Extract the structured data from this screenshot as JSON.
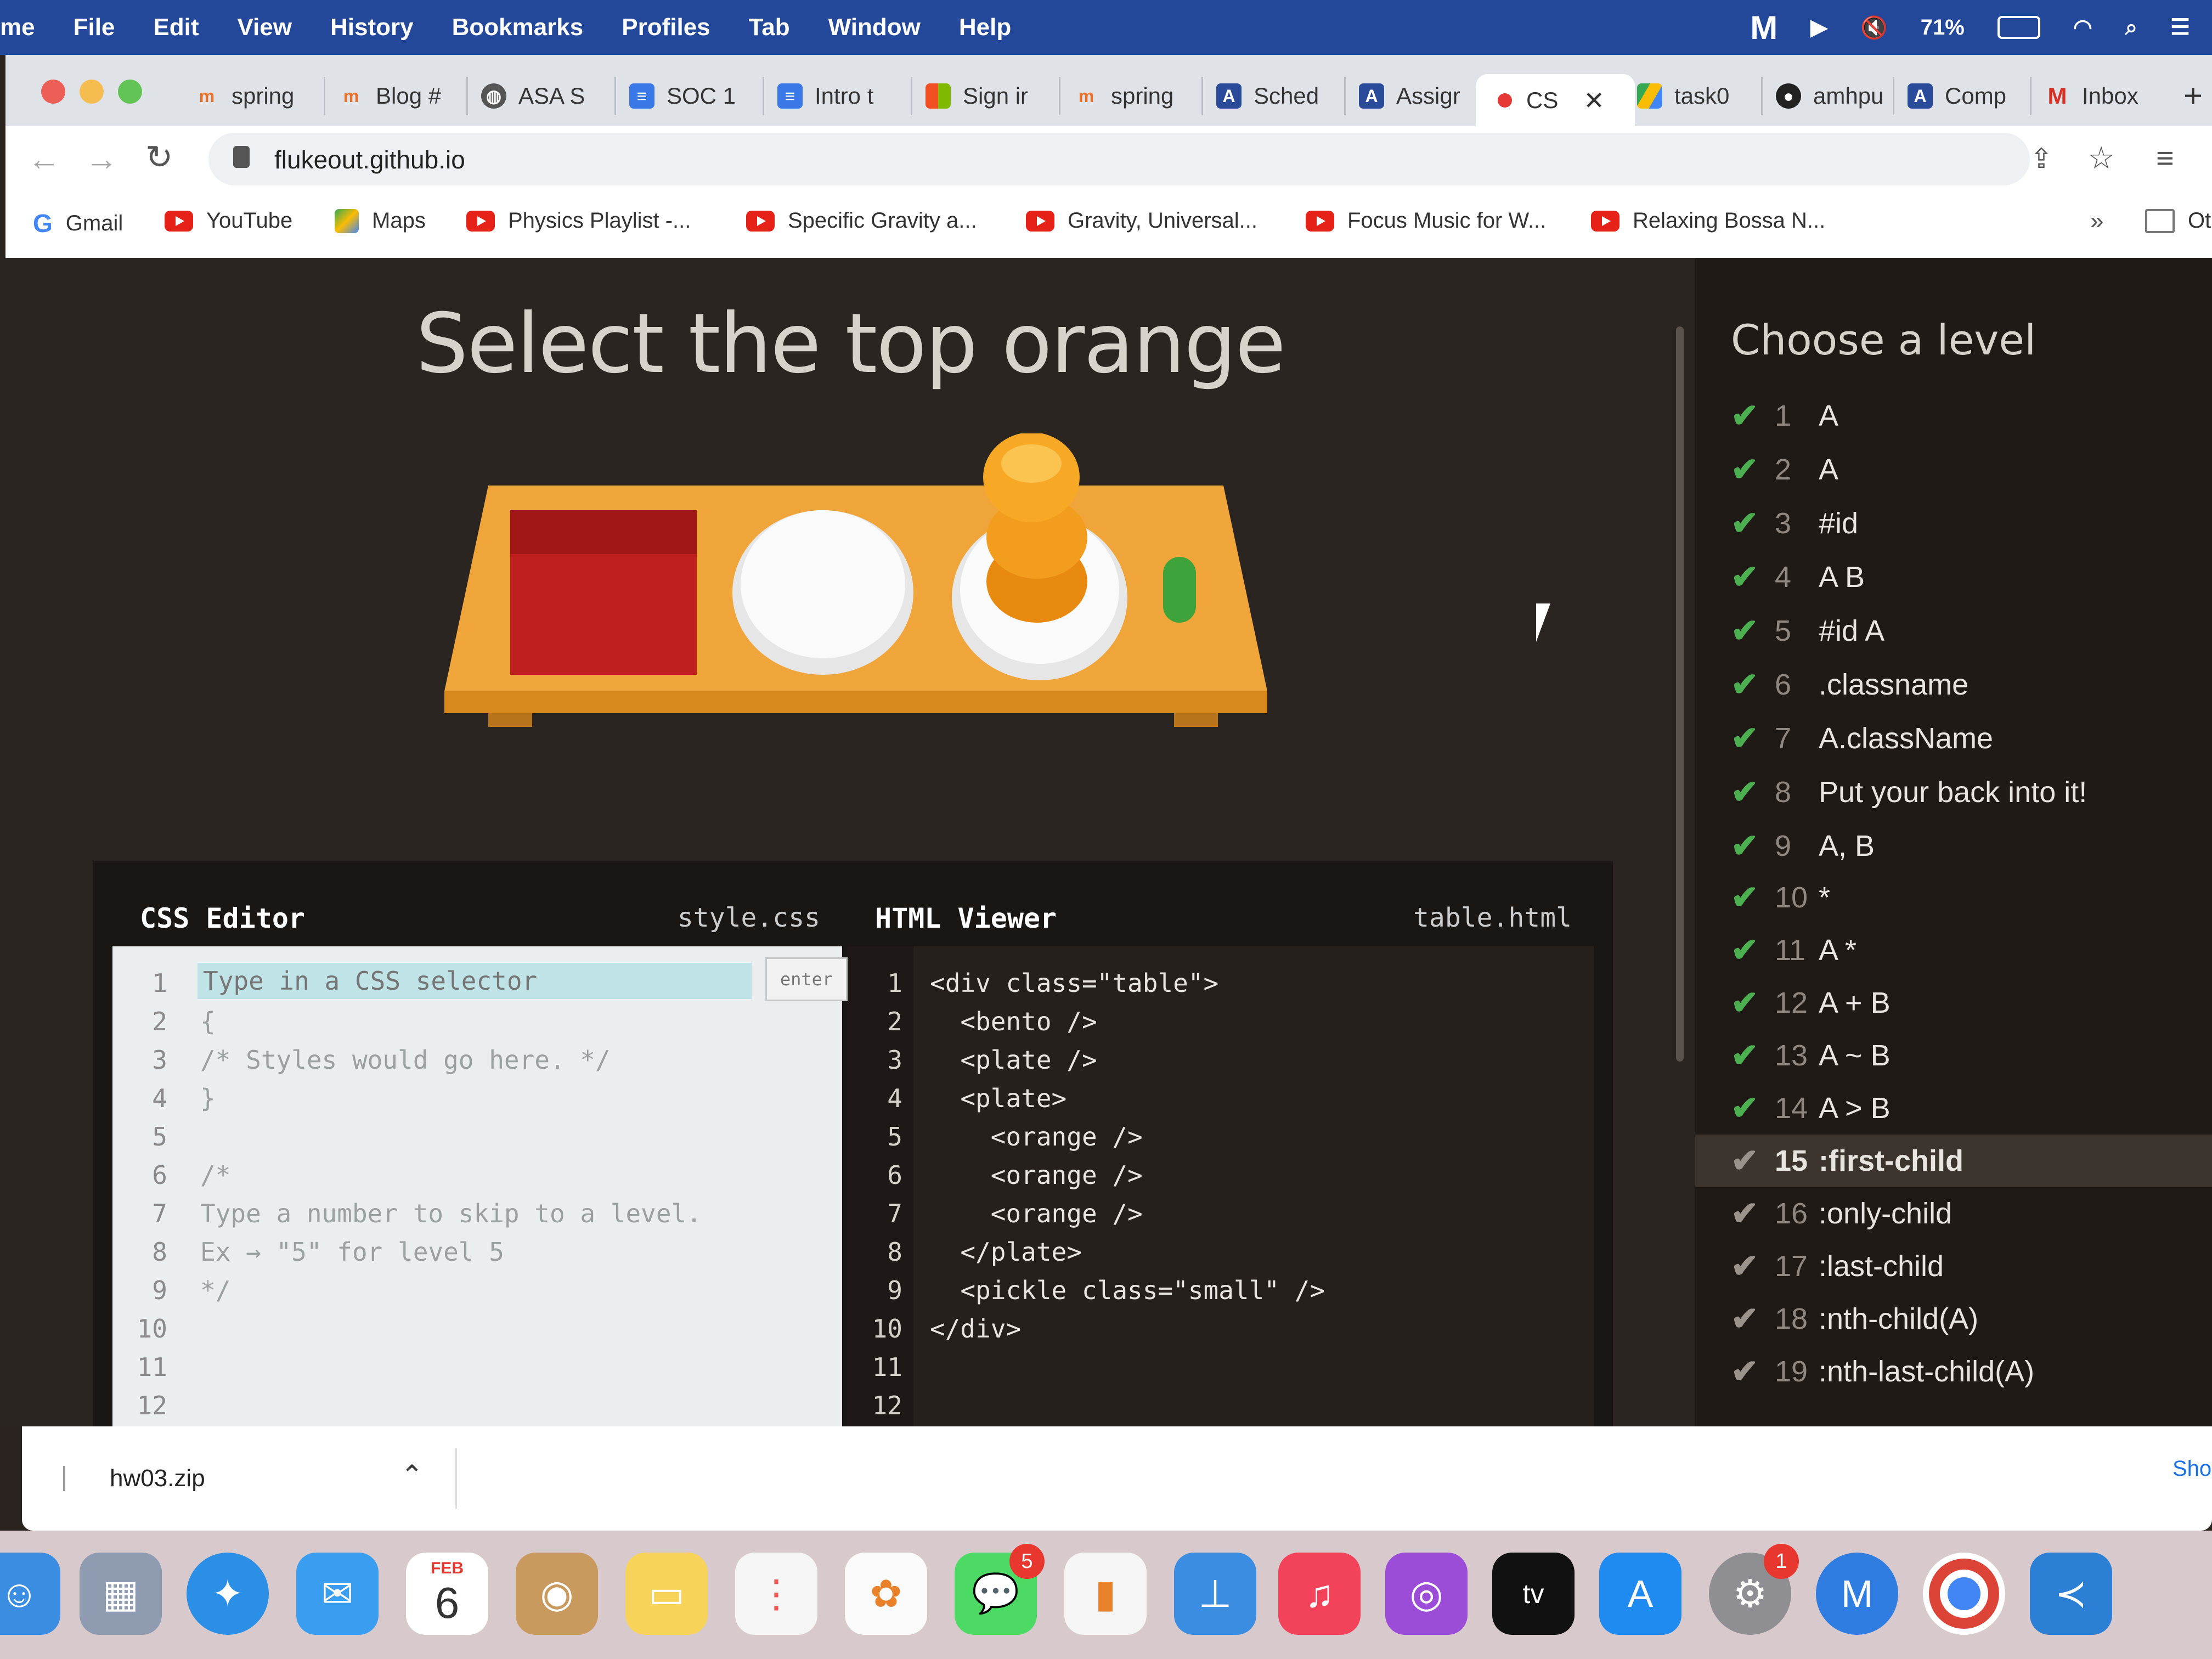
{
  "menubar": {
    "app_name": "me",
    "items": [
      "File",
      "Edit",
      "View",
      "History",
      "Bookmarks",
      "Profiles",
      "Tab",
      "Window",
      "Help"
    ],
    "battery": "71%"
  },
  "tabs": [
    {
      "label": "spring",
      "icon": "m"
    },
    {
      "label": "Blog #",
      "icon": "m"
    },
    {
      "label": "ASA S",
      "icon": "globe"
    },
    {
      "label": "SOC 1",
      "icon": "doc"
    },
    {
      "label": "Intro t",
      "icon": "doc"
    },
    {
      "label": "Sign ir",
      "icon": "ms"
    },
    {
      "label": "spring",
      "icon": "m"
    },
    {
      "label": "Sched",
      "icon": "A"
    },
    {
      "label": "Assigr",
      "icon": "A"
    }
  ],
  "active_tab": {
    "label": "CS"
  },
  "tabs_right": [
    {
      "label": "task0",
      "icon": "drive"
    },
    {
      "label": "amhpu",
      "icon": "github"
    },
    {
      "label": "Comp",
      "icon": "A"
    },
    {
      "label": "Inbox",
      "icon": "gmail"
    }
  ],
  "url": "flukeout.github.io",
  "bookmarks": [
    {
      "label": "Gmail",
      "icon": "google"
    },
    {
      "label": "YouTube",
      "icon": "youtube"
    },
    {
      "label": "Maps",
      "icon": "maps"
    },
    {
      "label": "Physics Playlist -...",
      "icon": "youtube"
    },
    {
      "label": "Specific Gravity a...",
      "icon": "youtube"
    },
    {
      "label": "Gravity, Universal...",
      "icon": "youtube"
    },
    {
      "label": "Focus Music for W...",
      "icon": "youtube"
    },
    {
      "label": "Relaxing Bossa N...",
      "icon": "youtube"
    }
  ],
  "bookmarks_more": "»",
  "bookmarks_other": "Ot",
  "game": {
    "title": "Select the top orange",
    "choose_level": "Choose a level",
    "levels": [
      {
        "n": "1",
        "label": "A"
      },
      {
        "n": "2",
        "label": "A"
      },
      {
        "n": "3",
        "label": "#id"
      },
      {
        "n": "4",
        "label": "A B"
      },
      {
        "n": "5",
        "label": "#id A"
      },
      {
        "n": "6",
        "label": ".classname"
      },
      {
        "n": "7",
        "label": "A.className"
      },
      {
        "n": "8",
        "label": "Put your back into it!"
      },
      {
        "n": "9",
        "label": "A, B"
      },
      {
        "n": "10",
        "label": "*"
      },
      {
        "n": "11",
        "label": "A *"
      },
      {
        "n": "12",
        "label": "A + B"
      },
      {
        "n": "13",
        "label": "A ~ B"
      },
      {
        "n": "14",
        "label": "A > B"
      },
      {
        "n": "15",
        "label": ":first-child"
      },
      {
        "n": "16",
        "label": ":only-child"
      },
      {
        "n": "17",
        "label": ":last-child"
      },
      {
        "n": "18",
        "label": ":nth-child(A)"
      },
      {
        "n": "19",
        "label": ":nth-last-child(A)"
      }
    ],
    "current_level": "15"
  },
  "css_editor": {
    "title": "CSS Editor",
    "file": "style.css",
    "placeholder": "Type in a CSS selector",
    "enter": "enter",
    "lines": [
      "",
      "{",
      "/* Styles would go here. */",
      "}",
      "",
      "/*",
      "Type a number to skip to a level.",
      "Ex → \"5\" for level 5",
      "*/",
      "",
      "",
      ""
    ],
    "line_numbers": [
      "1",
      "2",
      "3",
      "4",
      "5",
      "6",
      "7",
      "8",
      "9",
      "10",
      "11",
      "12"
    ]
  },
  "html_viewer": {
    "title": "HTML Viewer",
    "file": "table.html",
    "lines": [
      "<div class=\"table\">",
      "  <bento />",
      "  <plate />",
      "  <plate>",
      "    <orange />",
      "    <orange />",
      "    <orange />",
      "  </plate>",
      "  <pickle class=\"small\" />",
      "</div>",
      "",
      ""
    ],
    "line_numbers": [
      "1",
      "2",
      "3",
      "4",
      "5",
      "6",
      "7",
      "8",
      "9",
      "10",
      "11",
      "12"
    ]
  },
  "download": {
    "filename": "hw03.zip",
    "show_all": "Sho"
  },
  "dock": {
    "calendar_month": "FEB",
    "calendar_day": "6",
    "messages_badge": "5",
    "settings_badge": "1"
  }
}
